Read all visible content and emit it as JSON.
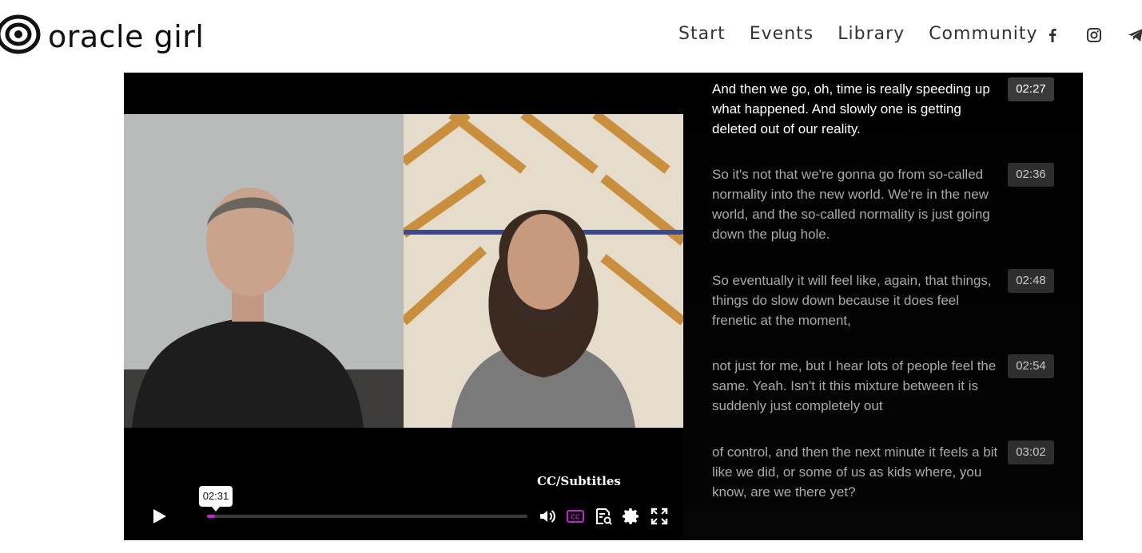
{
  "brand": {
    "name": "oracle girl"
  },
  "nav": [
    {
      "label": "Start"
    },
    {
      "label": "Events"
    },
    {
      "label": "Library"
    },
    {
      "label": "Community"
    }
  ],
  "social": [
    "facebook-icon",
    "instagram-icon",
    "telegram-icon"
  ],
  "player": {
    "tooltip_time": "02:31",
    "cc_label": "CC/Subtitles",
    "progress_fraction": 0.025,
    "accent_color": "#c81fd2"
  },
  "transcript": [
    {
      "text": "And then we go, oh, time is really speeding up what happened. And slowly one is getting deleted out of our reality.",
      "time": "02:27",
      "active": true
    },
    {
      "text": "So it's not that we're gonna go from so-called normality into the new world. We're in the new world, and the so-called normality is just going down the plug hole.",
      "time": "02:36",
      "active": false
    },
    {
      "text": "So eventually it will feel like, again, that things, things do slow down because it does feel frenetic at the moment,",
      "time": "02:48",
      "active": false
    },
    {
      "text": "not just for me, but I hear lots of people feel the same. Yeah. Isn't it this mixture between it is suddenly just completely out",
      "time": "02:54",
      "active": false
    },
    {
      "text": "of control, and then the next minute it feels a bit like we did, or some of us as kids where, you know, are we there yet?",
      "time": "03:02",
      "active": false
    }
  ]
}
